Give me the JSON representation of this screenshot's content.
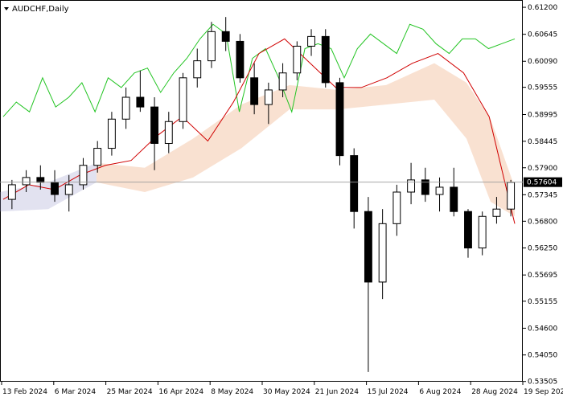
{
  "chart_data": {
    "type": "candlestick",
    "symbol_label": "AUDCHF,Daily",
    "current_price_label": "0.57604",
    "current_price": 0.57604,
    "ylim": [
      0.535,
      0.6135
    ],
    "y_ticks": [
      "0.61200",
      "0.60645",
      "0.60090",
      "0.59555",
      "0.58995",
      "0.58445",
      "0.57900",
      "0.57345",
      "0.56800",
      "0.56250",
      "0.55695",
      "0.55155",
      "0.54600",
      "0.54050",
      "0.53505"
    ],
    "x_ticks": [
      "13 Feb 2024",
      "6 Mar 2024",
      "25 Mar 2024",
      "16 Apr 2024",
      "8 May 2024",
      "30 May 2024",
      "21 Jun 2024",
      "15 Jul 2024",
      "6 Aug 2024",
      "28 Aug 2024",
      "19 Sep 2024"
    ],
    "grid": false,
    "colors": {
      "candle": "#000000",
      "tenkan": "#d00000",
      "kijun": "#1a1aa0",
      "chikou": "#22c422",
      "cloud_bull": "#e8935a",
      "cloud_bear": "#9898c8",
      "price_line": "#9a9a9a",
      "price_label_bg": "#000000",
      "price_label_text": "#ffffff"
    },
    "series": [
      {
        "name": "chikou",
        "x": [
          0,
          4,
          8,
          12,
          16,
          20,
          24,
          28,
          32,
          36,
          40,
          44,
          48,
          52,
          56,
          60,
          64,
          68,
          72,
          76,
          80,
          84,
          88,
          92,
          96,
          100,
          104,
          108,
          112,
          116,
          120,
          124,
          128,
          132,
          136,
          140,
          144,
          148,
          152,
          156
        ],
        "values": [
          0.5895,
          0.5925,
          0.5905,
          0.5975,
          0.5915,
          0.5935,
          0.5965,
          0.5905,
          0.5975,
          0.5955,
          0.5985,
          0.5995,
          0.5945,
          0.5985,
          0.6015,
          0.6055,
          0.6085,
          0.6065,
          0.5905,
          0.6015,
          0.6035,
          0.5975,
          0.5905,
          0.6035,
          0.6045,
          0.6035,
          0.5975,
          0.6035,
          0.6065,
          0.6045,
          0.6025,
          0.6085,
          0.6075,
          0.6045,
          0.6025,
          0.6055,
          0.6055,
          0.6035,
          0.6045,
          0.6055
        ]
      },
      {
        "name": "tenkan",
        "x": [
          0,
          10,
          20,
          30,
          40,
          50,
          60,
          70,
          80,
          90,
          100,
          110,
          120,
          130,
          140,
          150,
          160,
          170,
          180,
          190,
          200
        ],
        "values": [
          0.5725,
          0.5755,
          0.5745,
          0.5775,
          0.5795,
          0.5805,
          0.5855,
          0.5895,
          0.5845,
          0.5925,
          0.6025,
          0.6055,
          0.6005,
          0.5955,
          0.5955,
          0.5975,
          0.6005,
          0.6025,
          0.5985,
          0.5895,
          0.5675
        ]
      }
    ],
    "candles_ohlc": [
      [
        0.5725,
        0.5765,
        0.5705,
        0.5755
      ],
      [
        0.5755,
        0.5785,
        0.574,
        0.577
      ],
      [
        0.577,
        0.5795,
        0.5745,
        0.576
      ],
      [
        0.576,
        0.5785,
        0.572,
        0.5735
      ],
      [
        0.5735,
        0.5775,
        0.57,
        0.5755
      ],
      [
        0.5755,
        0.581,
        0.5745,
        0.5795
      ],
      [
        0.5795,
        0.5845,
        0.578,
        0.583
      ],
      [
        0.583,
        0.5905,
        0.5815,
        0.589
      ],
      [
        0.589,
        0.5955,
        0.587,
        0.5935
      ],
      [
        0.5935,
        0.599,
        0.5905,
        0.5915
      ],
      [
        0.5915,
        0.5935,
        0.5785,
        0.584
      ],
      [
        0.584,
        0.5905,
        0.582,
        0.5885
      ],
      [
        0.5885,
        0.5985,
        0.587,
        0.5975
      ],
      [
        0.5975,
        0.6035,
        0.5955,
        0.601
      ],
      [
        0.601,
        0.609,
        0.5995,
        0.607
      ],
      [
        0.607,
        0.61,
        0.603,
        0.605
      ],
      [
        0.605,
        0.6065,
        0.5965,
        0.5975
      ],
      [
        0.5975,
        0.6005,
        0.59,
        0.592
      ],
      [
        0.592,
        0.5965,
        0.588,
        0.595
      ],
      [
        0.595,
        0.6005,
        0.5935,
        0.5985
      ],
      [
        0.5985,
        0.605,
        0.597,
        0.604
      ],
      [
        0.604,
        0.6075,
        0.602,
        0.606
      ],
      [
        0.606,
        0.6075,
        0.5955,
        0.5965
      ],
      [
        0.5965,
        0.5975,
        0.5795,
        0.5815
      ],
      [
        0.5815,
        0.583,
        0.5665,
        0.57
      ],
      [
        0.57,
        0.573,
        0.537,
        0.5555
      ],
      [
        0.5555,
        0.5705,
        0.552,
        0.5675
      ],
      [
        0.5675,
        0.5755,
        0.565,
        0.574
      ],
      [
        0.574,
        0.58,
        0.5715,
        0.5765
      ],
      [
        0.5765,
        0.579,
        0.572,
        0.5735
      ],
      [
        0.5735,
        0.577,
        0.57,
        0.575
      ],
      [
        0.575,
        0.579,
        0.569,
        0.57
      ],
      [
        0.57,
        0.5705,
        0.5605,
        0.5625
      ],
      [
        0.5625,
        0.57,
        0.561,
        0.569
      ],
      [
        0.569,
        0.573,
        0.5675,
        0.5705
      ],
      [
        0.5705,
        0.5765,
        0.569,
        0.576
      ]
    ]
  }
}
